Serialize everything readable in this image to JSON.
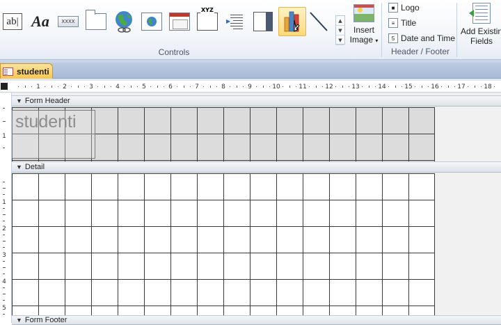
{
  "ribbon": {
    "controls_group_label": "Controls",
    "option_group_label": "XYZ",
    "button_label": "XXXX",
    "insert_image": {
      "line1": "Insert",
      "line2": "Image"
    },
    "header_footer": {
      "label": "Header / Footer",
      "items": [
        "Logo",
        "Title",
        "Date and Time"
      ]
    },
    "existing_fields": {
      "line1": "Add Existing",
      "line2": "Fields"
    }
  },
  "document": {
    "tab_label": "studenti",
    "title_text": "studenti"
  },
  "sections": {
    "form_header": "Form Header",
    "detail": "Detail",
    "form_footer": "Form Footer"
  },
  "colors": {
    "tab_active": "#f8c650",
    "grid_line": "#3a3a3a"
  }
}
